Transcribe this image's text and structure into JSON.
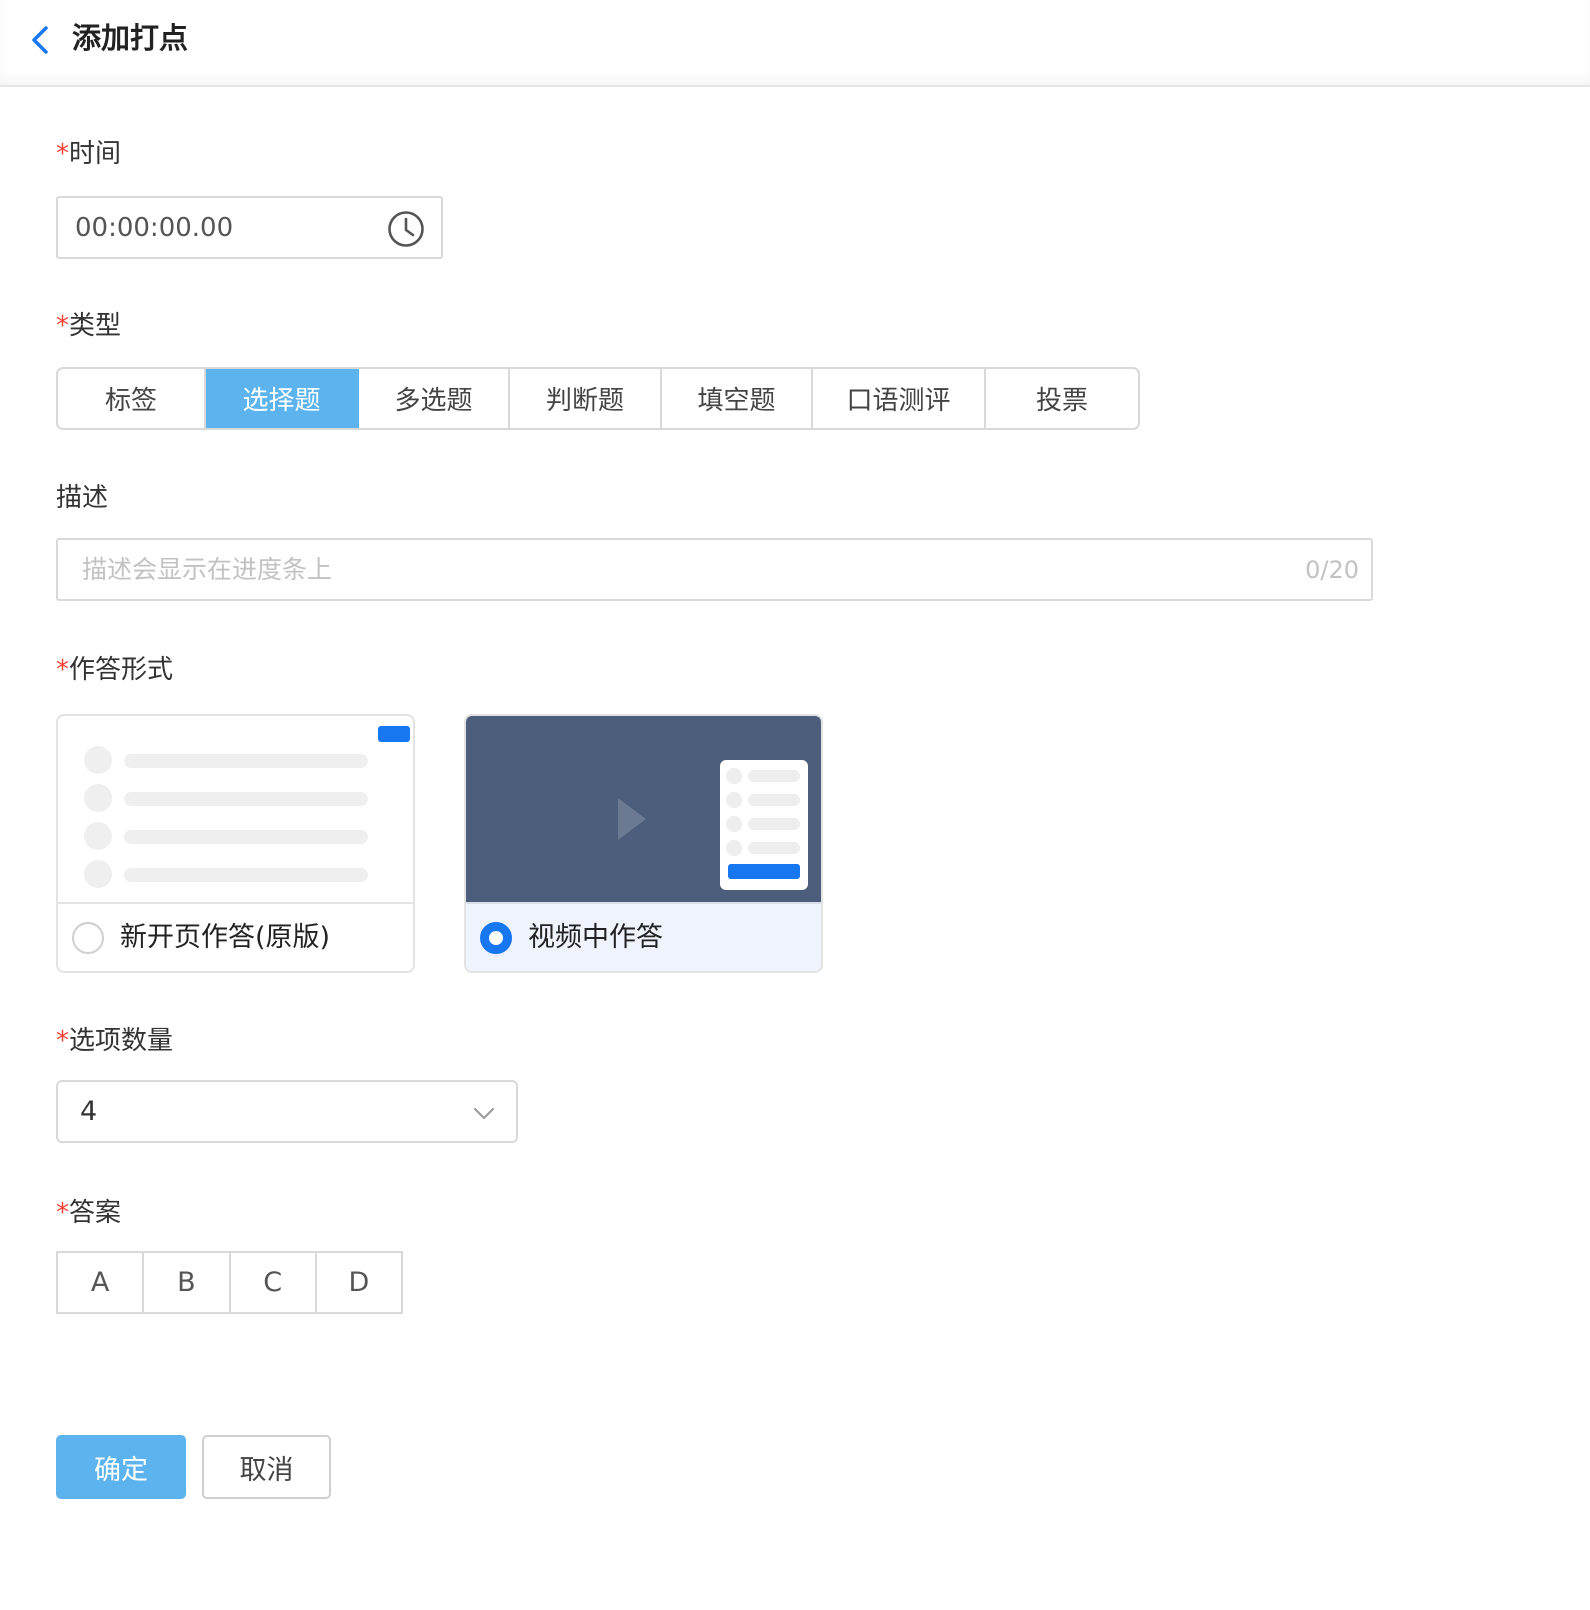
{
  "header": {
    "title": "添加打点"
  },
  "form": {
    "time": {
      "label": "时间",
      "value": "00:00:00.00"
    },
    "type": {
      "label": "类型",
      "options": [
        "标签",
        "选择题",
        "多选题",
        "判断题",
        "填空题",
        "口语测评",
        "投票"
      ],
      "selected": "选择题"
    },
    "description": {
      "label": "描述",
      "placeholder": "描述会显示在进度条上",
      "counter": "0/20"
    },
    "answer_mode": {
      "label": "作答形式",
      "options": [
        {
          "label": "新开页作答(原版)",
          "selected": false
        },
        {
          "label": "视频中作答",
          "selected": true
        }
      ]
    },
    "option_count": {
      "label": "选项数量",
      "value": "4"
    },
    "answer": {
      "label": "答案",
      "options": [
        "A",
        "B",
        "C",
        "D"
      ]
    }
  },
  "actions": {
    "confirm": "确定",
    "cancel": "取消"
  },
  "colors": {
    "accent": "#5cb3ed",
    "primary_blue": "#1677f0",
    "required": "#f04134",
    "video_bg": "#4c5e7b"
  }
}
